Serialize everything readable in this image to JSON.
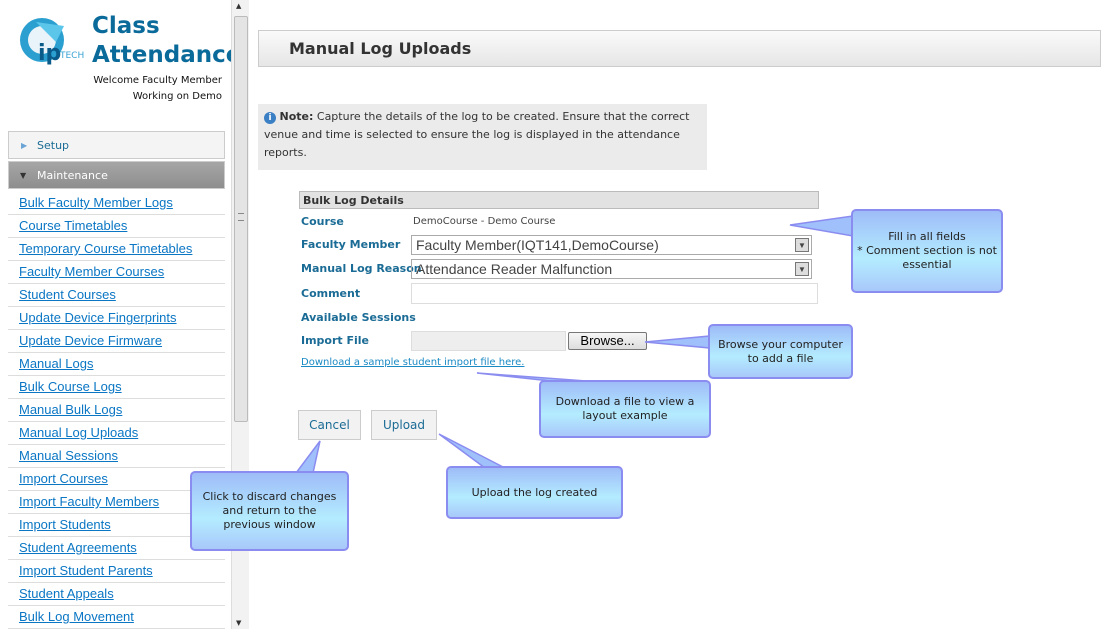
{
  "app": {
    "title_line1": "Class",
    "title_line2": "Attendance",
    "logo_text": "TECH",
    "welcome": "Welcome Faculty Member",
    "working_on": "Working on Demo"
  },
  "sidebar": {
    "setup": "Setup",
    "maintenance": "Maintenance",
    "items": [
      "Bulk Faculty Member Logs",
      "Course Timetables",
      "Temporary Course Timetables",
      "Faculty Member Courses",
      "Student Courses",
      "Update Device Fingerprints",
      "Update Device Firmware",
      "Manual Logs",
      "Bulk Course Logs",
      "Manual Bulk Logs",
      "Manual Log Uploads",
      "Manual Sessions",
      "Import Courses",
      "Import Faculty Members",
      "Import Students",
      "Student Agreements",
      "Import Student Parents",
      "Student Appeals",
      "Bulk Log Movement"
    ]
  },
  "page": {
    "title": "Manual Log Uploads",
    "note_label": "Note:",
    "note_text": " Capture the details of the log to be created. Ensure that the correct venue and time is selected to ensure the log is displayed in the attendance reports."
  },
  "form": {
    "section": "Bulk Log Details",
    "course_label": "Course",
    "course_value": "DemoCourse - Demo Course",
    "faculty_label": "Faculty Member",
    "faculty_value": "Faculty Member(IQT141,DemoCourse)",
    "reason_label": "Manual Log Reason",
    "reason_value": "Attendance Reader Malfunction",
    "comment_label": "Comment",
    "comment_value": "",
    "sessions_label": "Available Sessions",
    "import_label": "Import File",
    "browse": "Browse...",
    "download_link": "Download a sample student import file here.",
    "cancel": "Cancel",
    "upload": "Upload"
  },
  "callouts": {
    "fill": "Fill in all fields\n* Comment section is not essential",
    "browse": "Browse your computer to add a file",
    "download": "Download a file to view a layout example",
    "cancel": "Click to discard changes and return to the previous window",
    "upload": "Upload the log created"
  }
}
